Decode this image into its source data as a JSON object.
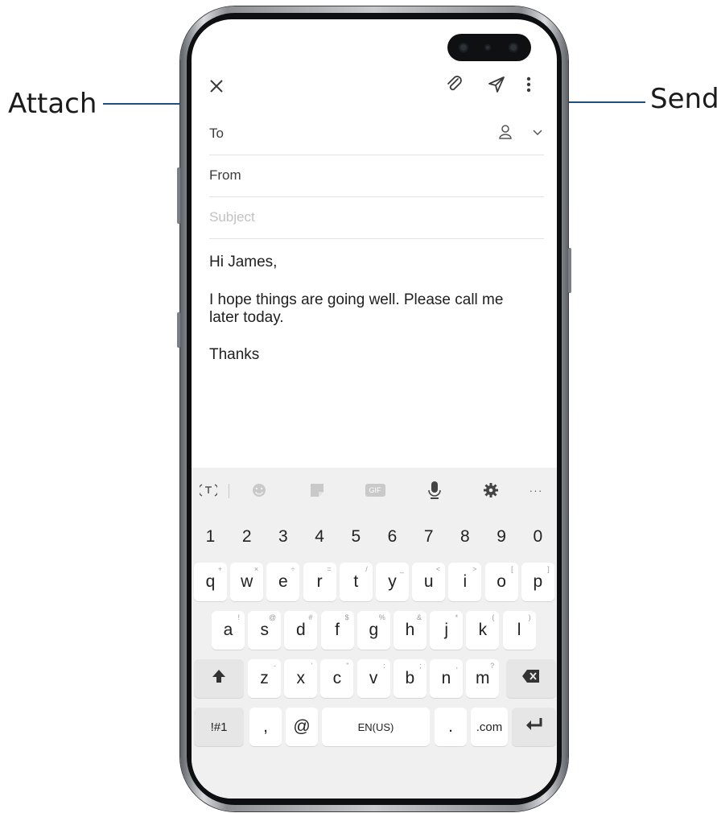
{
  "callouts": {
    "attach": "Attach",
    "send": "Send"
  },
  "header": {
    "close_icon": "close-icon",
    "attach_icon": "paperclip-icon",
    "send_icon": "send-icon",
    "more_icon": "more-vert-icon"
  },
  "fields": {
    "to_label": "To",
    "from_label": "From",
    "subject_placeholder": "Subject"
  },
  "message": {
    "greeting": "Hi James,",
    "body": "I hope things are going well. Please call me later today.",
    "closing": "Thanks"
  },
  "keyboard": {
    "toolbar": [
      "text-style-icon",
      "emoji-icon",
      "sticker-icon",
      "gif-icon",
      "microphone-icon",
      "settings-icon",
      "more-horiz-icon"
    ],
    "gif_label": "GIF",
    "more_label": "···",
    "number_row": [
      "1",
      "2",
      "3",
      "4",
      "5",
      "6",
      "7",
      "8",
      "9",
      "0"
    ],
    "row1": [
      {
        "k": "q",
        "h": "+"
      },
      {
        "k": "w",
        "h": "×"
      },
      {
        "k": "e",
        "h": "÷"
      },
      {
        "k": "r",
        "h": "="
      },
      {
        "k": "t",
        "h": "/"
      },
      {
        "k": "y",
        "h": "_"
      },
      {
        "k": "u",
        "h": "<"
      },
      {
        "k": "i",
        "h": ">"
      },
      {
        "k": "o",
        "h": "["
      },
      {
        "k": "p",
        "h": "]"
      }
    ],
    "row2": [
      {
        "k": "a",
        "h": "!"
      },
      {
        "k": "s",
        "h": "@"
      },
      {
        "k": "d",
        "h": "#"
      },
      {
        "k": "f",
        "h": "$"
      },
      {
        "k": "g",
        "h": "%"
      },
      {
        "k": "h",
        "h": "&"
      },
      {
        "k": "j",
        "h": "*"
      },
      {
        "k": "k",
        "h": "("
      },
      {
        "k": "l",
        "h": ")"
      }
    ],
    "row3": [
      {
        "k": "z",
        "h": "-"
      },
      {
        "k": "x",
        "h": "'"
      },
      {
        "k": "c",
        "h": "\""
      },
      {
        "k": "v",
        "h": ":"
      },
      {
        "k": "b",
        "h": ";"
      },
      {
        "k": "n",
        "h": ","
      },
      {
        "k": "m",
        "h": "?"
      }
    ],
    "symbols_key": "!#1",
    "comma_key": ",",
    "at_key": "@",
    "space_key": "EN(US)",
    "period_key": ".",
    "dotcom_key": ".com"
  },
  "colors": {
    "callout_line": "#1f4f80",
    "keyboard_bg": "#f0f0f0"
  }
}
